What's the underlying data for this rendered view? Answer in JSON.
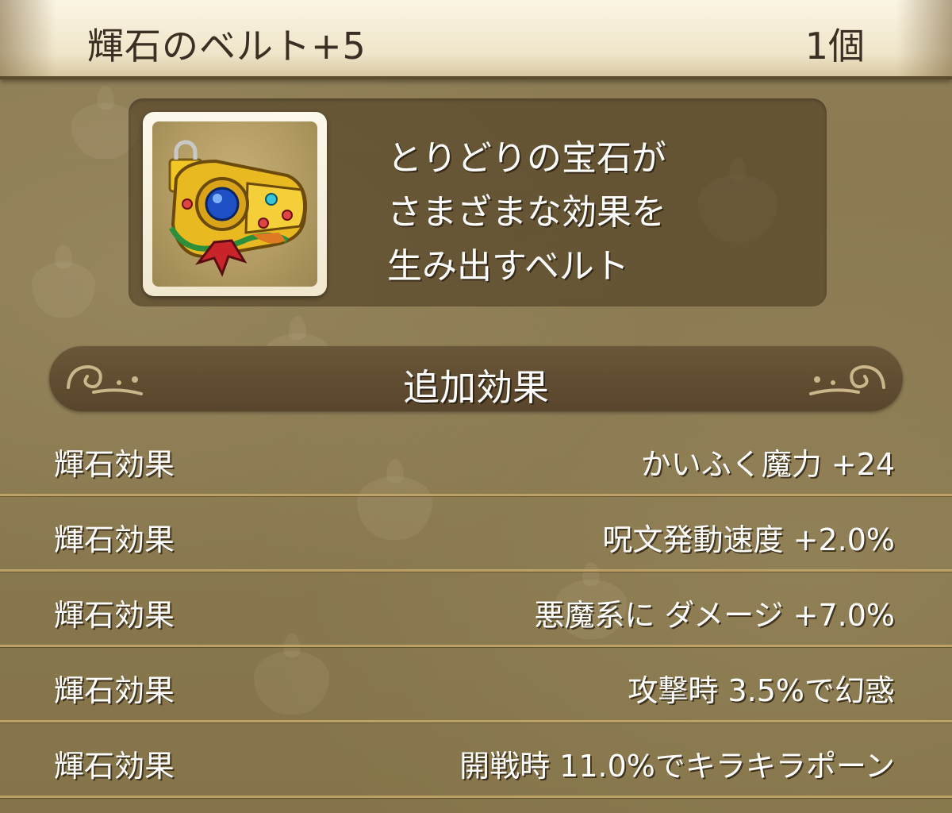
{
  "header": {
    "item_name": "輝石のベルト+5",
    "quantity": "1個"
  },
  "item": {
    "icon": "jeweled-belt-icon",
    "description": "とりどりの宝石が\nさまざまな効果を\n生み出すベルト"
  },
  "section": {
    "title": "追加効果"
  },
  "effects": [
    {
      "label": "輝石効果",
      "value": "かいふく魔力 +24"
    },
    {
      "label": "輝石効果",
      "value": "呪文発動速度 +2.0%"
    },
    {
      "label": "輝石効果",
      "value": "悪魔系に ダメージ +7.0%"
    },
    {
      "label": "輝石効果",
      "value": "攻撃時 3.5%で幻惑"
    },
    {
      "label": "輝石効果",
      "value": "開戦時 11.0%でキラキラポーン"
    }
  ],
  "colors": {
    "panel_bg": "#8a7a52",
    "header_bg": "#f3ead2",
    "section_bar": "#5f4c31",
    "row_divider": "#cdaf6e"
  }
}
